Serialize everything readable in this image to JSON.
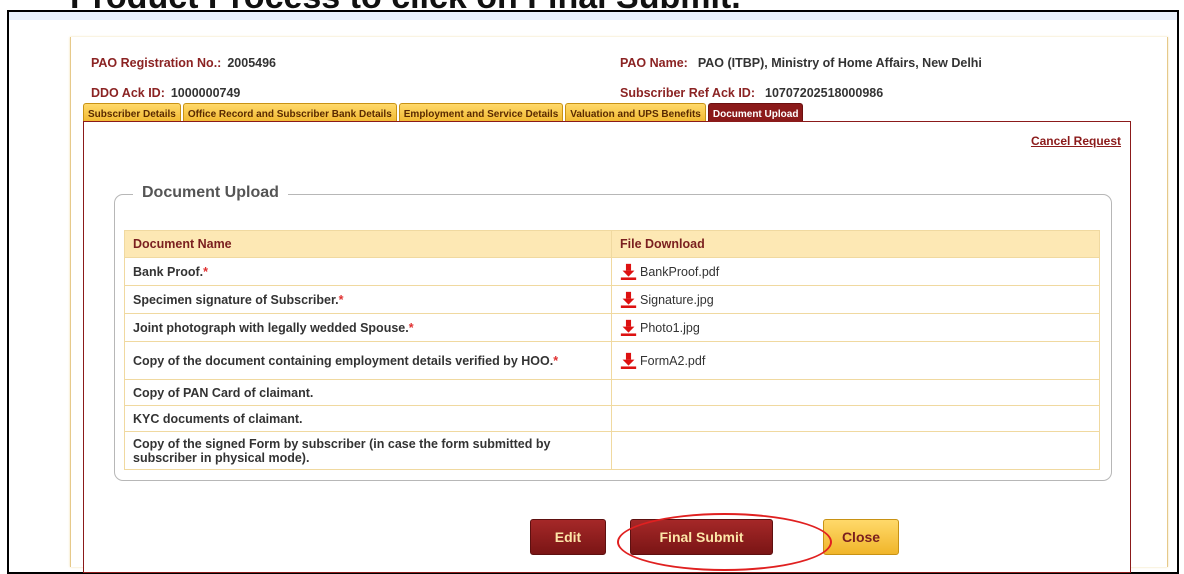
{
  "caption": "Product Process to click on Final Submit.",
  "info": {
    "pao_reg_label": "PAO Registration No.:",
    "pao_reg_value": "2005496",
    "pao_name_label": "PAO Name:",
    "pao_name_value": "PAO (ITBP), Ministry of Home Affairs, New Delhi",
    "ddo_ack_label": "DDO Ack ID:",
    "ddo_ack_value": "1000000749",
    "subscriber_ref_label": "Subscriber Ref Ack ID:",
    "subscriber_ref_value": "10707202518000986"
  },
  "tabs": [
    {
      "label": "Subscriber Details",
      "active": false
    },
    {
      "label": "Office Record and Subscriber Bank Details",
      "active": false
    },
    {
      "label": "Employment and Service Details",
      "active": false
    },
    {
      "label": "Valuation and UPS Benefits",
      "active": false
    },
    {
      "label": "Document Upload",
      "active": true
    }
  ],
  "cancel_request": "Cancel Request",
  "section_title": "Document Upload",
  "table": {
    "headers": [
      "Document Name",
      "File Download"
    ],
    "rows": [
      {
        "name": "Bank Proof.",
        "required": true,
        "file": "BankProof.pdf"
      },
      {
        "name": "Specimen signature of Subscriber.",
        "required": true,
        "file": "Signature.jpg"
      },
      {
        "name": "Joint photograph with legally wedded Spouse.",
        "required": true,
        "file": "Photo1.jpg"
      },
      {
        "name": "Copy of the document containing employment details verified by HOO.",
        "required": true,
        "file": "FormA2.pdf"
      },
      {
        "name": "Copy of PAN Card of claimant.",
        "required": false,
        "file": ""
      },
      {
        "name": "KYC documents of claimant.",
        "required": false,
        "file": ""
      },
      {
        "name": "Copy of the signed Form by subscriber (in case the form submitted by subscriber in physical mode).",
        "required": false,
        "file": ""
      }
    ]
  },
  "buttons": {
    "edit": "Edit",
    "final_submit": "Final Submit",
    "close": "Close"
  },
  "required_mark": "*",
  "colors": {
    "maroon": "#8b1a1a",
    "gold": "#f0b52a",
    "highlight": "#e02020"
  },
  "icons": {
    "download": "download-icon"
  }
}
